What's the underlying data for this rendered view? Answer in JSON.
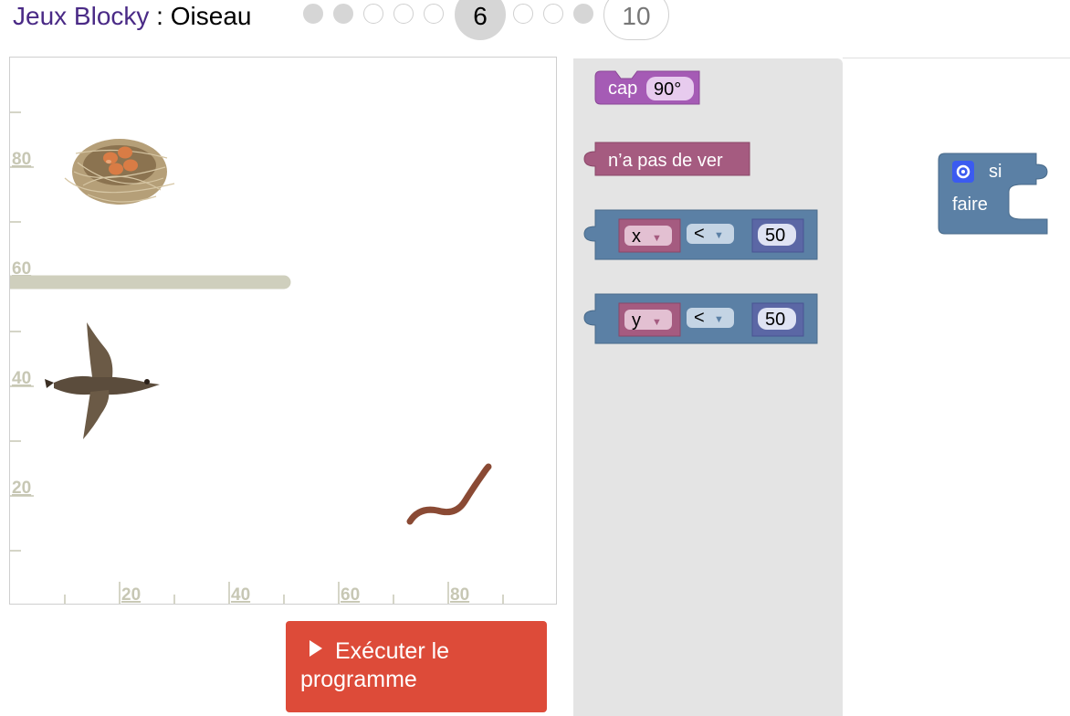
{
  "header": {
    "app_title": "Jeux Blocky",
    "separator": " : ",
    "game_name": "Oiseau",
    "current_level": "6",
    "last_level": "10",
    "levels": [
      {
        "state": "done"
      },
      {
        "state": "done"
      },
      {
        "state": "todo"
      },
      {
        "state": "todo"
      },
      {
        "state": "todo"
      },
      {
        "state": "current"
      },
      {
        "state": "todo"
      },
      {
        "state": "todo"
      },
      {
        "state": "done"
      },
      {
        "state": "last"
      }
    ]
  },
  "stage": {
    "y_ticks": [
      "80",
      "60",
      "40",
      "20"
    ],
    "x_ticks": [
      "20",
      "40",
      "60",
      "80"
    ],
    "objects": [
      "nest",
      "bird",
      "worm",
      "wall"
    ]
  },
  "run_button": {
    "label_line1": "Exécuter le",
    "label_line2": "programme"
  },
  "toolbox": {
    "heading_block": {
      "label": "cap",
      "value": "90°"
    },
    "no_worm_block": {
      "label": "n’a pas de ver"
    },
    "compare_x": {
      "var": "x",
      "op": "<",
      "value": "50"
    },
    "compare_y": {
      "var": "y",
      "op": "<",
      "value": "50"
    }
  },
  "workspace": {
    "if_block": {
      "label_if": "si",
      "label_do": "faire"
    }
  },
  "colors": {
    "title_purple": "#4a2a86",
    "run_red": "#dd4b39",
    "block_heading": "#a55bb5",
    "block_logic": "#a55b80",
    "block_compare": "#5b80a5",
    "axis_color": "#c7c7b4",
    "toolbox_bg": "#e4e4e4"
  }
}
